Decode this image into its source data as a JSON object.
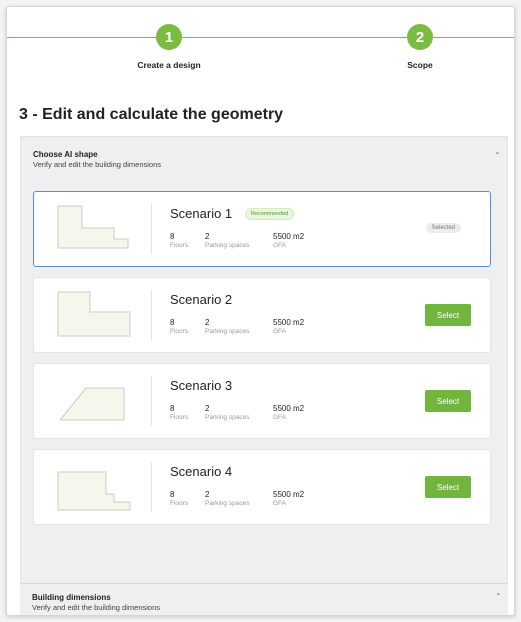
{
  "stepper": {
    "steps": [
      {
        "number": "1",
        "label": "Create a design"
      },
      {
        "number": "2",
        "label": "Scope"
      }
    ]
  },
  "section_title": "3 - Edit and calculate the geometry",
  "shape_panel": {
    "title": "Choose AI shape",
    "subtitle": "Verify and edit the building dimensions",
    "chevron": "chevron-up-icon"
  },
  "scenarios": [
    {
      "name": "Scenario 1",
      "badge": "Recommended",
      "floors": "8",
      "floors_label": "Floors",
      "parking": "2",
      "parking_label": "Parking spaces",
      "gfa": "5500 m2",
      "gfa_label": "GFA",
      "status": "Selected",
      "shape": "step-shape"
    },
    {
      "name": "Scenario 2",
      "floors": "8",
      "floors_label": "Floors",
      "parking": "2",
      "parking_label": "Parking spaces",
      "gfa": "5500 m2",
      "gfa_label": "GFA",
      "action": "Select",
      "shape": "l-shape"
    },
    {
      "name": "Scenario 3",
      "floors": "8",
      "floors_label": "Floors",
      "parking": "2",
      "parking_label": "Parking spaces",
      "gfa": "5500 m2",
      "gfa_label": "GFA",
      "action": "Select",
      "shape": "trapezoid-shape"
    },
    {
      "name": "Scenario 4",
      "floors": "8",
      "floors_label": "Floors",
      "parking": "2",
      "parking_label": "Parking spaces",
      "gfa": "5500 m2",
      "gfa_label": "GFA",
      "action": "Select",
      "shape": "step-shape"
    }
  ],
  "dimensions_panel": {
    "title": "Building dimensions",
    "subtitle": "Verify and edit the building dimensions",
    "chevron": "chevron-up-icon"
  },
  "colors": {
    "accent": "#7cbb42",
    "button": "#72b53d",
    "selected_border": "#5a8fd6"
  }
}
